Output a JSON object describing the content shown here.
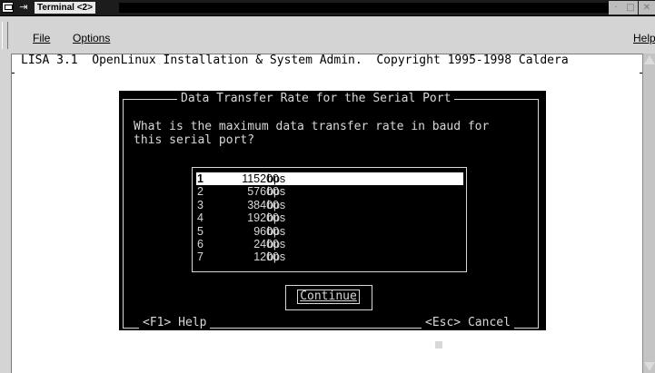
{
  "window": {
    "title": "Terminal <2>",
    "minimize_glyph": "·",
    "maximize_glyph": "□",
    "close_glyph": "✕",
    "pin_glyph": "⇥"
  },
  "menubar": {
    "file_label": "File",
    "options_label": "Options",
    "help_label": "Help"
  },
  "terminal": {
    "header": "LISA 3.1  OpenLinux Installation & System Admin.  Copyright 1995-1998 Caldera"
  },
  "dialog": {
    "title": "Data Transfer Rate for the Serial Port",
    "question": "What is the maximum data transfer rate in baud for\nthis serial port?",
    "options": [
      {
        "num": "1",
        "rate": "115200",
        "unit": "bps"
      },
      {
        "num": "2",
        "rate": "57600",
        "unit": "bps"
      },
      {
        "num": "3",
        "rate": "38400",
        "unit": "bps"
      },
      {
        "num": "4",
        "rate": "19200",
        "unit": "bps"
      },
      {
        "num": "5",
        "rate": "9600",
        "unit": "bps"
      },
      {
        "num": "6",
        "rate": "2400",
        "unit": "bps"
      },
      {
        "num": "7",
        "rate": "1200",
        "unit": "bps"
      }
    ],
    "selected_index": 0,
    "continue_label": "Continue",
    "footer_help": "<F1> Help",
    "footer_cancel": "<Esc> Cancel"
  },
  "colors": {
    "terminal_bg": "#000000",
    "terminal_fg": "#d8d8d8",
    "selection_bg": "#ffffff",
    "chrome_bg": "#d4d4d4"
  }
}
